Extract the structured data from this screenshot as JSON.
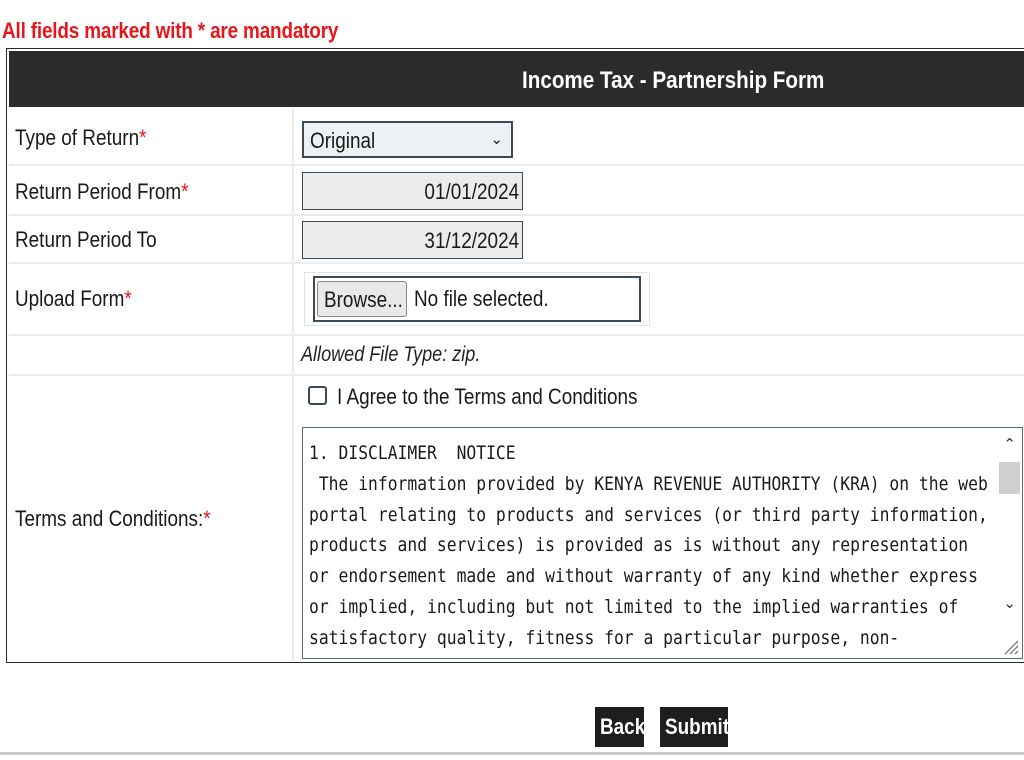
{
  "notice": {
    "text": "All fields marked with * are mandatory"
  },
  "form": {
    "title": "Income Tax - Partnership Form",
    "required_marker": "*",
    "type_of_return": {
      "label": "Type of Return",
      "selected": "Original"
    },
    "period_from": {
      "label": "Return Period From",
      "value": "01/01/2024"
    },
    "period_to": {
      "label": "Return Period To",
      "value": "31/12/2024"
    },
    "upload": {
      "label": "Upload Form",
      "browse_label": "Browse...",
      "status": "No file selected.",
      "allowed": "Allowed File Type: zip."
    },
    "agree": {
      "label": "I Agree to the Terms and Conditions",
      "checked": false
    },
    "terms": {
      "label": "Terms and Conditions:",
      "text": "1. DISCLAIMER  NOTICE\n The information provided by KENYA REVENUE AUTHORITY (KRA) on the web\nportal relating to products and services (or third party information,\nproducts and services) is provided as is without any representation\nor endorsement made and without warranty of any kind whether express\nor implied, including but not limited to the implied warranties of\nsatisfactory quality, fitness for a particular purpose, non-"
    }
  },
  "actions": {
    "back": "Back",
    "submit": "Submit"
  },
  "colors": {
    "header_bg": "#2b2b2b",
    "required": "#e8161c",
    "button_bg": "#1e1e1e"
  },
  "icons": {
    "select_arrow": "chevron-down-icon",
    "scroll_up": "chevron-up-icon",
    "scroll_down": "chevron-down-icon",
    "resize": "resize-grip-icon"
  }
}
